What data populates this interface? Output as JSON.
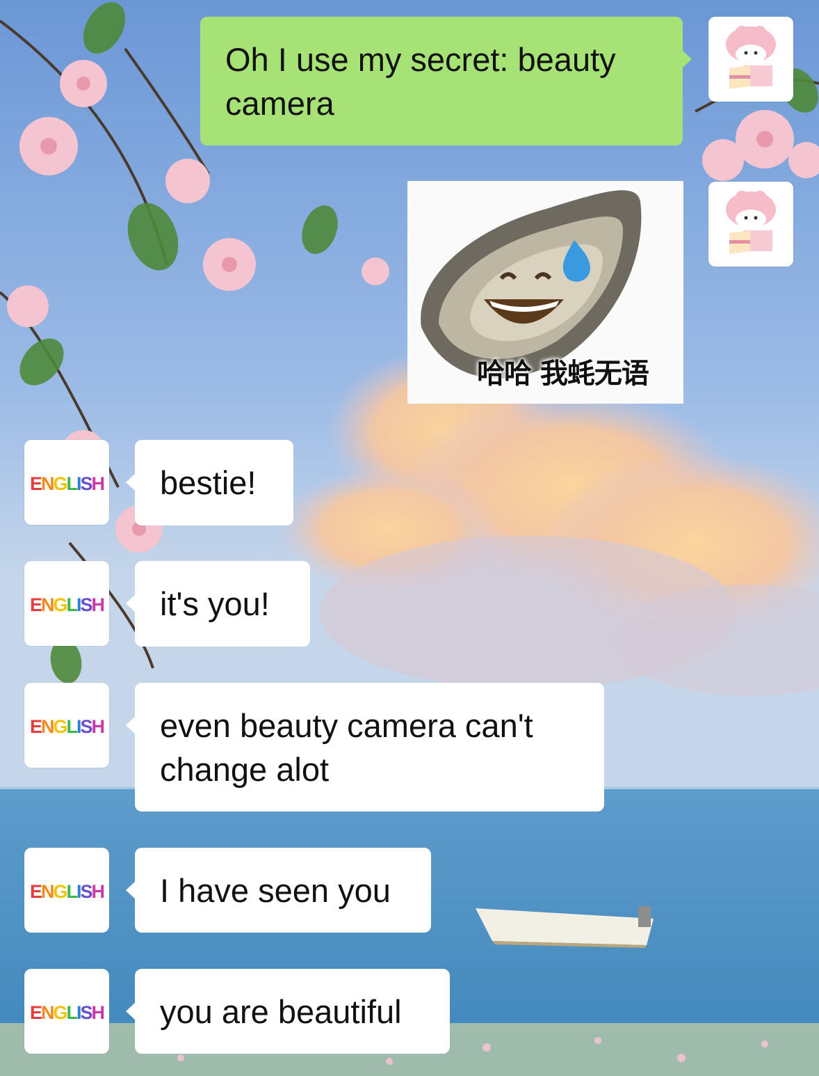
{
  "chat": {
    "messages": [
      {
        "id": "m1",
        "from": "me",
        "type": "text",
        "text": "Oh I use my secret: beauty camera"
      },
      {
        "id": "m2",
        "from": "me",
        "type": "sticker",
        "caption": "哈哈 我蚝无语"
      },
      {
        "id": "m3",
        "from": "contact",
        "type": "text",
        "text": "bestie!"
      },
      {
        "id": "m4",
        "from": "contact",
        "type": "text",
        "text": "it's you!"
      },
      {
        "id": "m5",
        "from": "contact",
        "type": "text",
        "text": "even beauty camera can't change alot"
      },
      {
        "id": "m6",
        "from": "contact",
        "type": "text",
        "text": "I have seen you"
      },
      {
        "id": "m7",
        "from": "contact",
        "type": "text",
        "text": "you are beautiful"
      }
    ]
  },
  "contact_avatar": {
    "logo_text": "ENGLISH",
    "icon": "english-logo-icon"
  },
  "my_avatar": {
    "icon": "bunny-cake-icon"
  },
  "colors": {
    "outgoing_bubble": "#a6e275",
    "incoming_bubble": "#ffffff",
    "sky_top": "#6e9ad8",
    "sea": "#4f8fc0"
  }
}
